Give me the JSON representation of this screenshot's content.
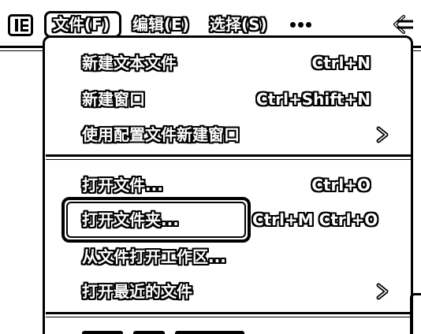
{
  "menubar": {
    "items": [
      {
        "label": "文件(F)"
      },
      {
        "label": "编辑(E)"
      },
      {
        "label": "选择(S)"
      }
    ],
    "more_icon": "ellipsis-icon",
    "back_icon": "arrow-left-icon",
    "app_icon": "vscode-layout-icon"
  },
  "dropdown": {
    "groups": [
      {
        "items": [
          {
            "label": "新建文本文件",
            "shortcut": "Ctrl+N"
          },
          {
            "label": "新建窗口",
            "shortcut": "Ctrl+Shift+N"
          },
          {
            "label": "使用配置文件新建窗口",
            "submenu": true
          }
        ]
      },
      {
        "items": [
          {
            "label": "打开文件...",
            "shortcut": "Ctrl+O"
          },
          {
            "label": "打开文件夹...",
            "shortcut": "Ctrl+M Ctrl+O",
            "highlighted": true
          },
          {
            "label": "从文件打开工作区..."
          },
          {
            "label": "打开最近的文件",
            "submenu": true
          }
        ]
      }
    ]
  }
}
